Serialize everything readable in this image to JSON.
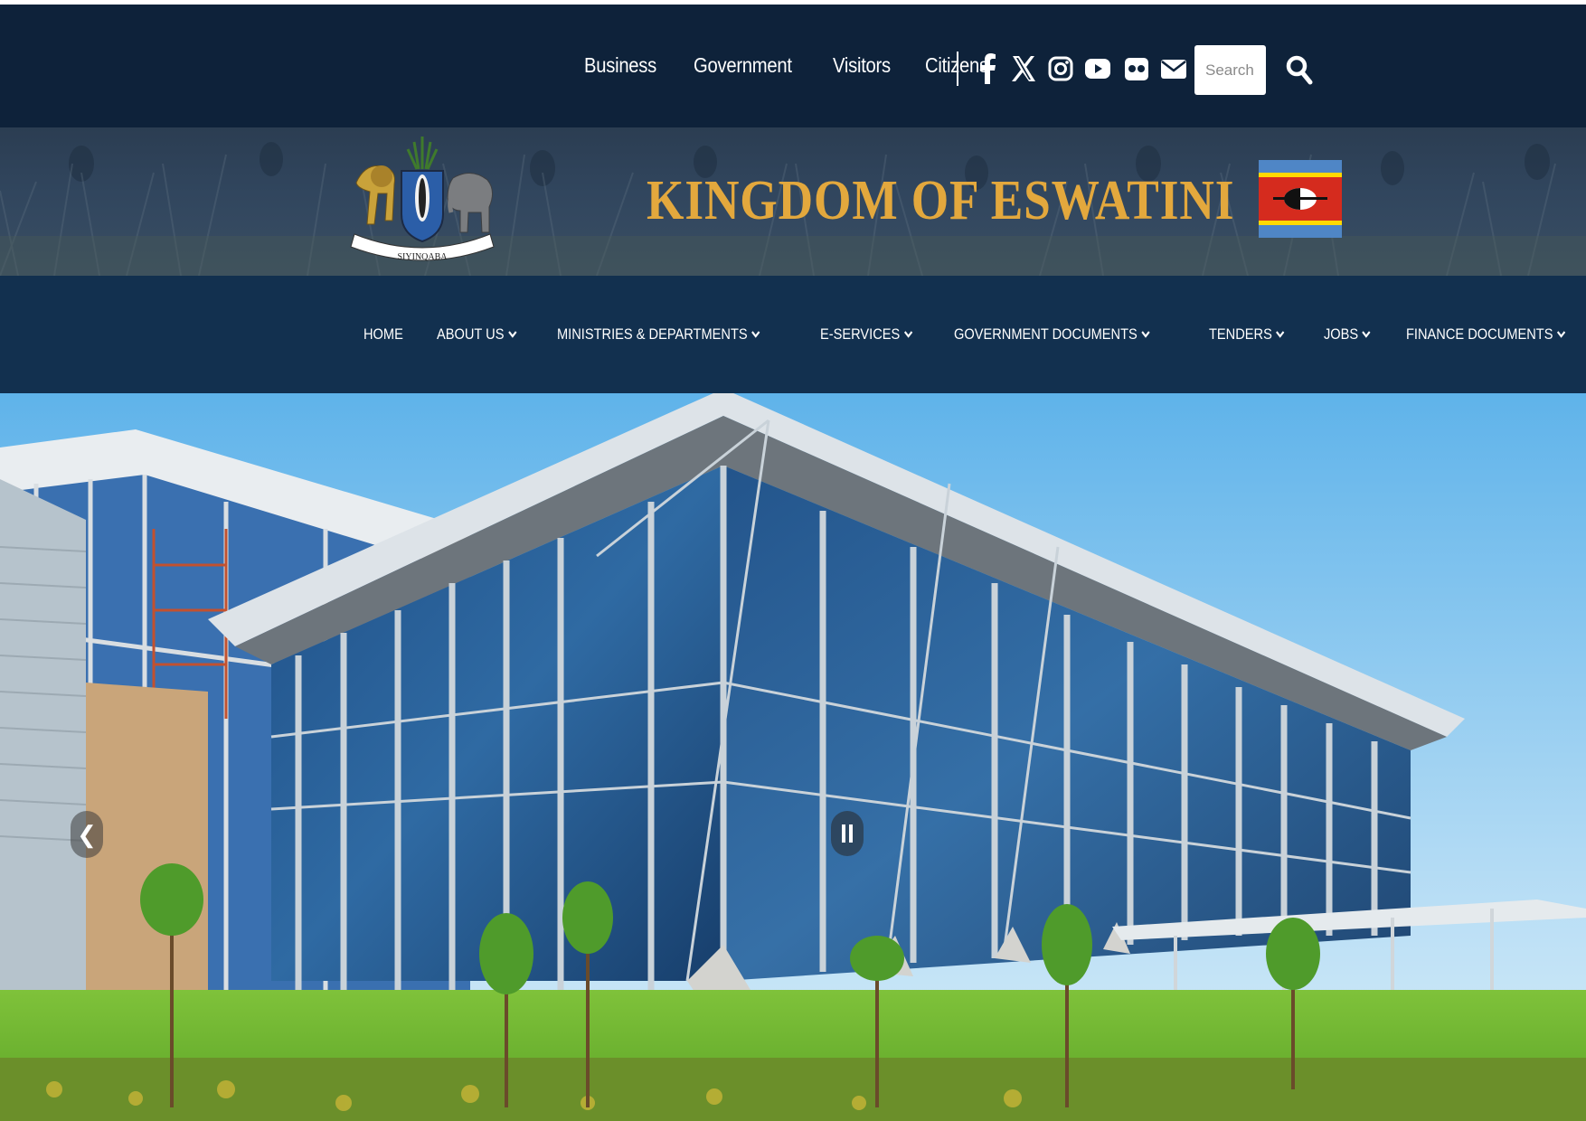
{
  "topbar": {
    "links": [
      "Business",
      "Government",
      "Visitors",
      "Citizens"
    ],
    "social_icons": [
      "facebook-icon",
      "x-icon",
      "instagram-icon",
      "youtube-icon",
      "flickr-icon",
      "email-icon"
    ],
    "search": {
      "placeholder": "Search..."
    },
    "background": "#0e223a"
  },
  "banner": {
    "title": "KINGDOM OF ESWATINI",
    "coat_of_arms_motto": "SIYINQABA",
    "title_color": "#e3a83d"
  },
  "nav": {
    "items": [
      {
        "label": "HOME",
        "dropdown": false
      },
      {
        "label": "ABOUT US",
        "dropdown": true
      },
      {
        "label": "MINISTRIES & DEPARTMENTS",
        "dropdown": true
      },
      {
        "label": "E-SERVICES",
        "dropdown": true
      },
      {
        "label": "GOVERNMENT DOCUMENTS",
        "dropdown": true
      },
      {
        "label": "TENDERS",
        "dropdown": true
      },
      {
        "label": "JOBS",
        "dropdown": true
      },
      {
        "label": "FINANCE DOCUMENTS",
        "dropdown": true
      }
    ],
    "background": "#12304f"
  },
  "hero": {
    "prev_label": "❮",
    "slideshow_state": "playing"
  }
}
